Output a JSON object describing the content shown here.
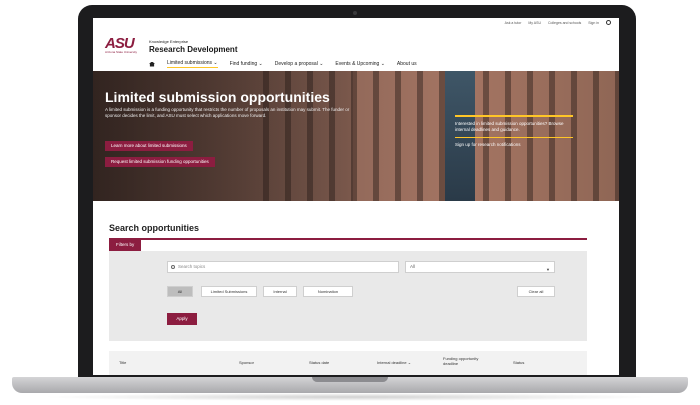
{
  "colors": {
    "brand": "#8c1d40",
    "accent": "#ffc627",
    "frame": "#1c1c1e"
  },
  "utility": {
    "links": [
      "Ask a tutor",
      "My ASU",
      "Colleges and schools",
      "Sign in"
    ],
    "search_icon": "search-icon"
  },
  "header": {
    "logo": "ASU",
    "logo_sub": "Arizona State University",
    "eyebrow": "Knowledge Enterprise",
    "unit": "Research Development"
  },
  "nav": {
    "home_icon": "home-icon",
    "items": [
      {
        "label": "Limited submissions ⌄",
        "active": true
      },
      {
        "label": "Find funding ⌄"
      },
      {
        "label": "Develop a proposal ⌄"
      },
      {
        "label": "Events & Upcoming ⌄"
      },
      {
        "label": "About us"
      }
    ]
  },
  "hero": {
    "title": "Limited submission opportunities",
    "description": "A limited submission is a funding opportunity that restricts the number of proposals an institution may submit. The funder or sponsor decides the limit, and ASU must select which applications move forward.",
    "btn_learn": "Learn more about limited submissions",
    "btn_request": "Request limited submission funding opportunities",
    "callout_text": "Interested in limited submission opportunities? Browse internal deadlines and guidance.",
    "callout_link": "Sign up for research notifications"
  },
  "search": {
    "title": "Search opportunities",
    "filter_tab": "Filters by",
    "keyword_placeholder": "Search topics",
    "category_value": "All",
    "chips": [
      "All",
      "Limited Submissions",
      "Internal",
      "Nomination"
    ],
    "clear": "Clear all",
    "apply": "Apply"
  },
  "table": {
    "headers": [
      "Title",
      "Sponsor",
      "Status date",
      "Internal deadline ⌄",
      "Funding opportunity deadline",
      "Status"
    ]
  }
}
